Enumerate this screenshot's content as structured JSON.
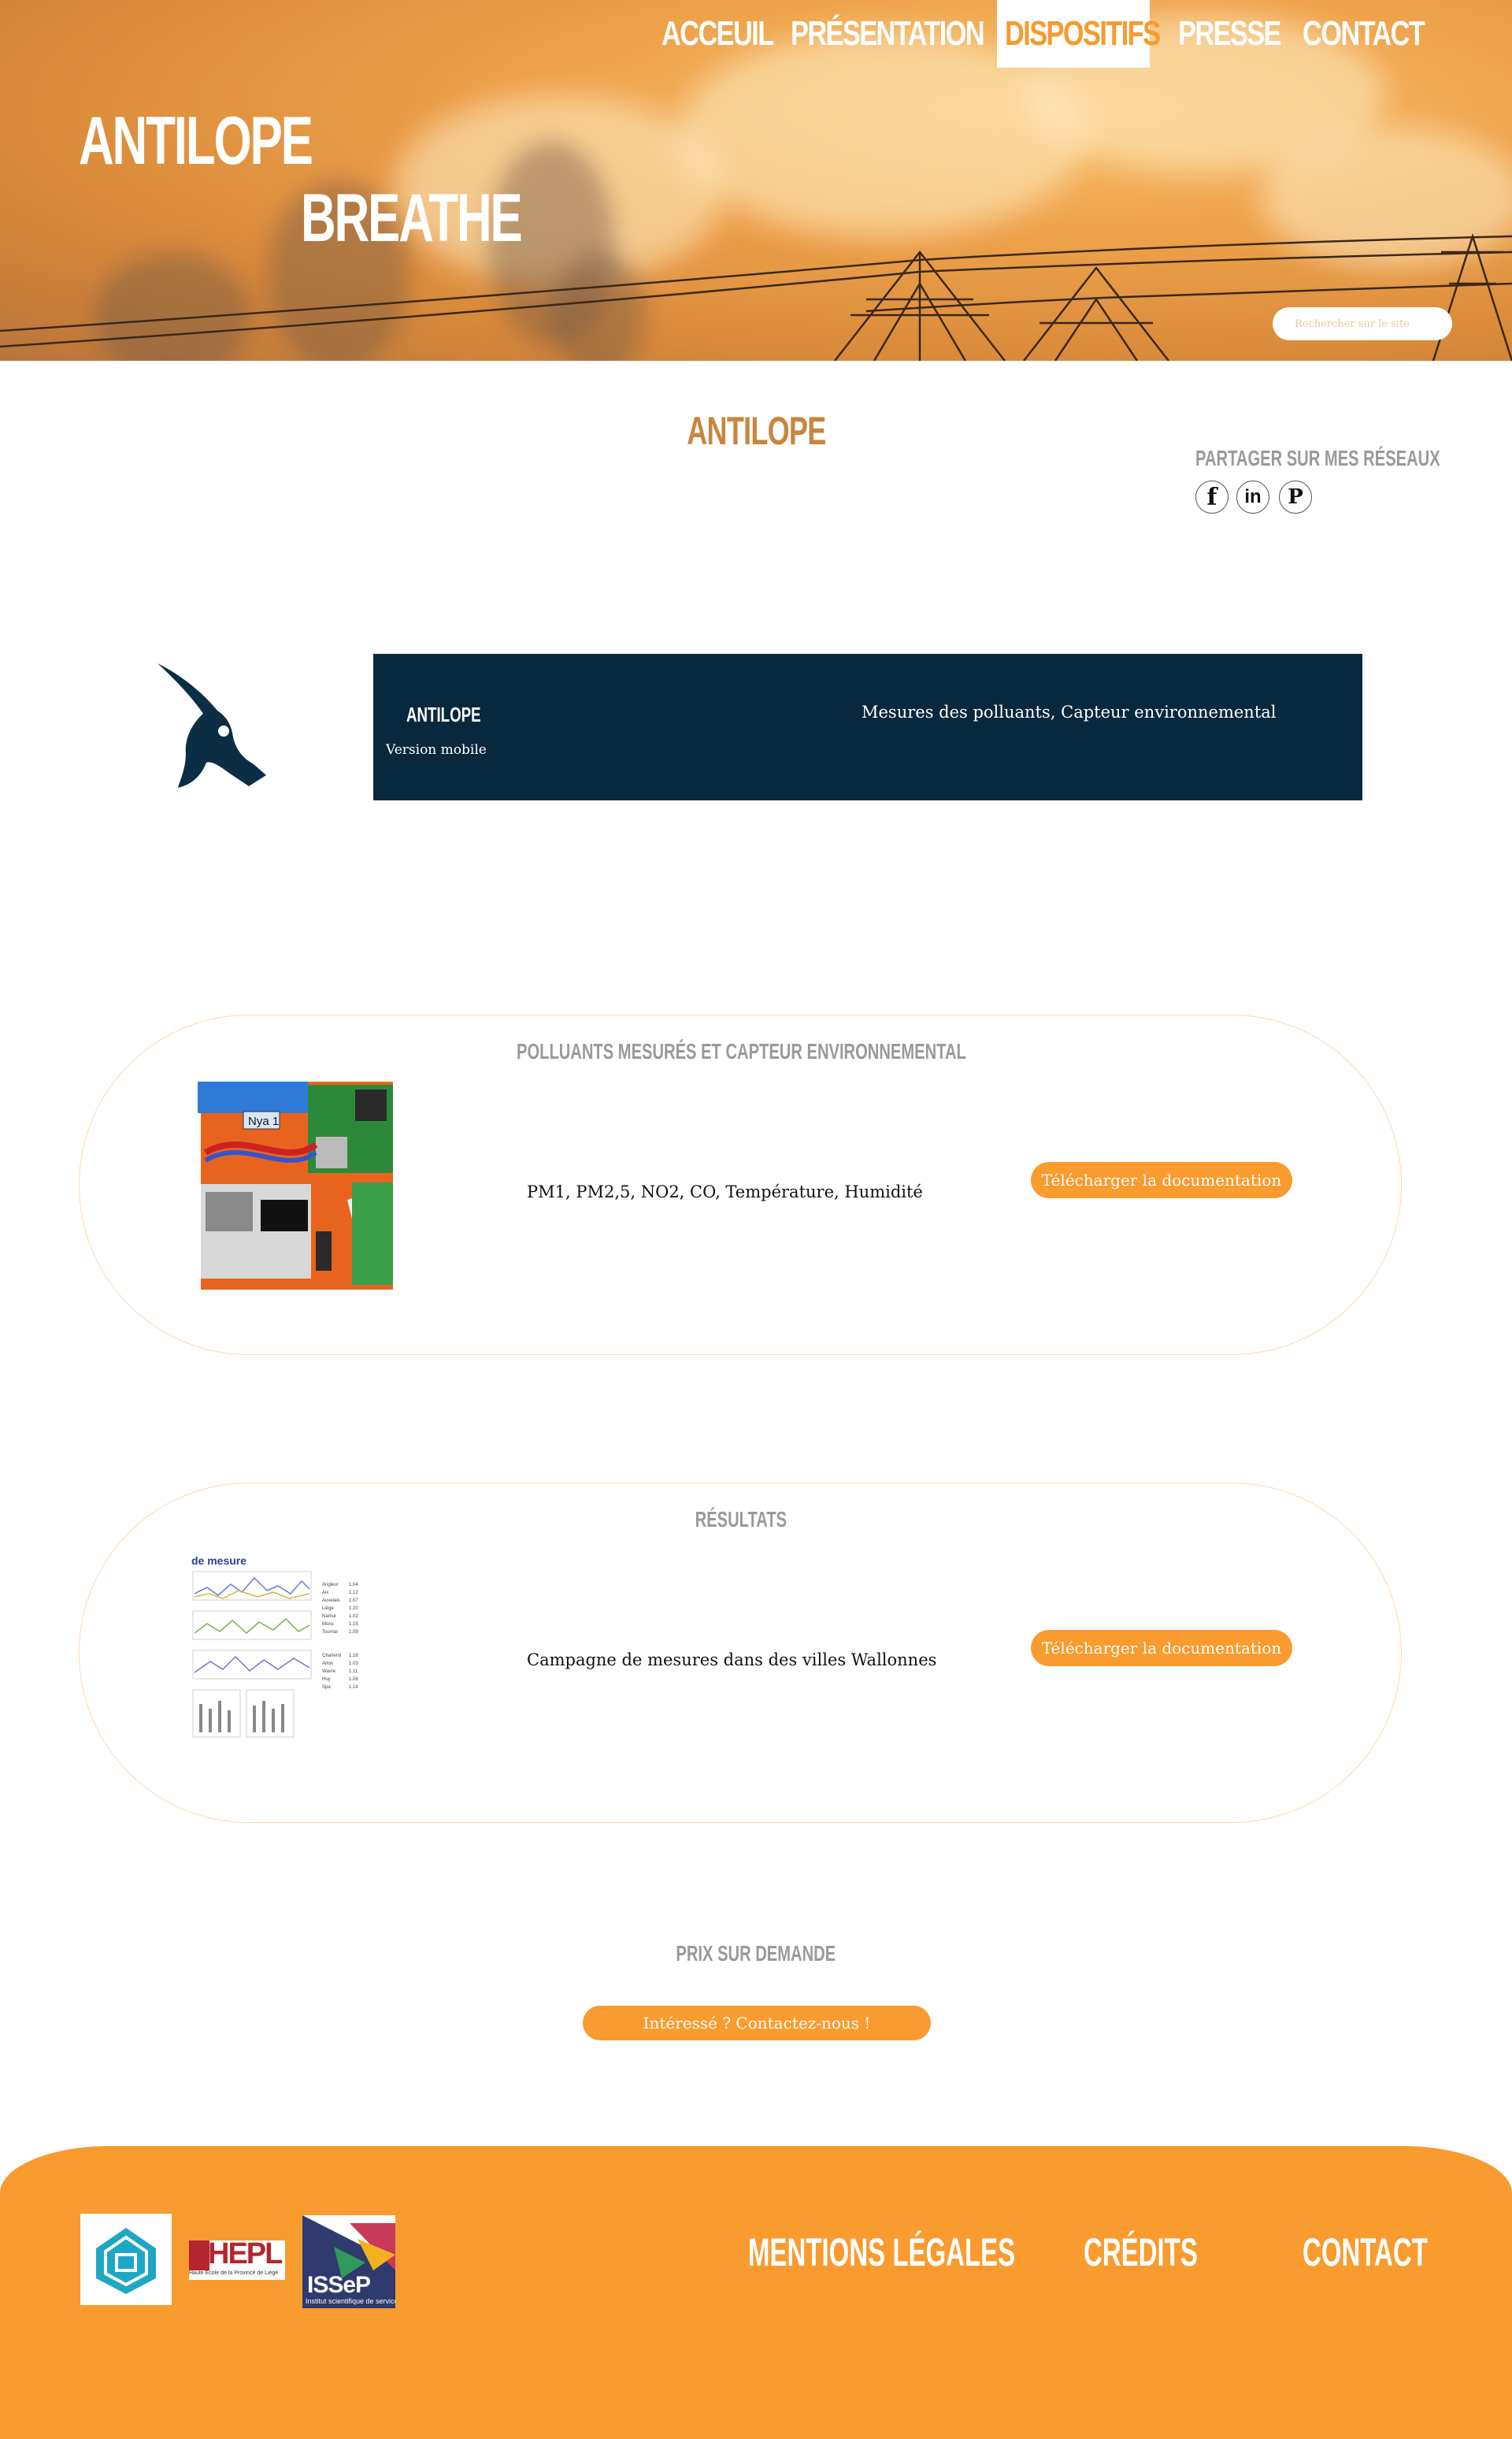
{
  "colors": {
    "accent": "#f99b2e",
    "title_orange": "#c9853e",
    "banner_navy": "#08293d",
    "section_gray": "#9a9a9a"
  },
  "nav": {
    "items": [
      {
        "label": "ACCEUIL",
        "active": false
      },
      {
        "label": "PRÉSENTATION",
        "active": false
      },
      {
        "label": "DISPOSITIFS",
        "active": true
      },
      {
        "label": "PRESSE",
        "active": false
      },
      {
        "label": "CONTACT",
        "active": false
      }
    ]
  },
  "brand": {
    "line1": "ANTILOPE",
    "line2": "BREATHE"
  },
  "search": {
    "placeholder": "Rechercher sur le site"
  },
  "page": {
    "title": "ANTILOPE"
  },
  "share": {
    "label": "PARTAGER SUR MES RÉSEAUX",
    "networks": [
      {
        "icon": "facebook-icon",
        "glyph": "f"
      },
      {
        "icon": "linkedin-icon",
        "glyph": "in"
      },
      {
        "icon": "pinterest-icon",
        "glyph": "P"
      }
    ]
  },
  "product": {
    "icon": "antelope-icon",
    "name": "ANTILOPE",
    "version": "Version mobile",
    "description": "Mesures des polluants, Capteur environnemental"
  },
  "sections": [
    {
      "title": "POLLUANTS MESURÉS ET CAPTEUR ENVIRONNEMENTAL",
      "text": "PM1, PM2,5, NO2, CO, Température, Humidité",
      "button": "Télécharger la documentation",
      "image": "sensor-board-photo"
    },
    {
      "title": "RÉSULTATS",
      "text": "Campagne de mesures dans des villes Wallonnes",
      "button": "Télécharger la documentation",
      "image": "results-chart-thumbnail",
      "image_caption": "de mesure"
    }
  ],
  "pricing": {
    "label": "PRIX SUR DEMANDE",
    "button": "Intéressé ? Contactez-nous !"
  },
  "footer": {
    "logos": [
      {
        "name": "logo-1",
        "text": ""
      },
      {
        "name": "hepl-logo",
        "text": "HEPL",
        "subtext": "Haute Ecole de la Province de Liège"
      },
      {
        "name": "issep-logo",
        "text": "ISSeP",
        "subtext": "Institut scientifique de service public"
      }
    ],
    "links": [
      "MENTIONS LÉGALES",
      "CRÉDITS",
      "CONTACT"
    ]
  }
}
